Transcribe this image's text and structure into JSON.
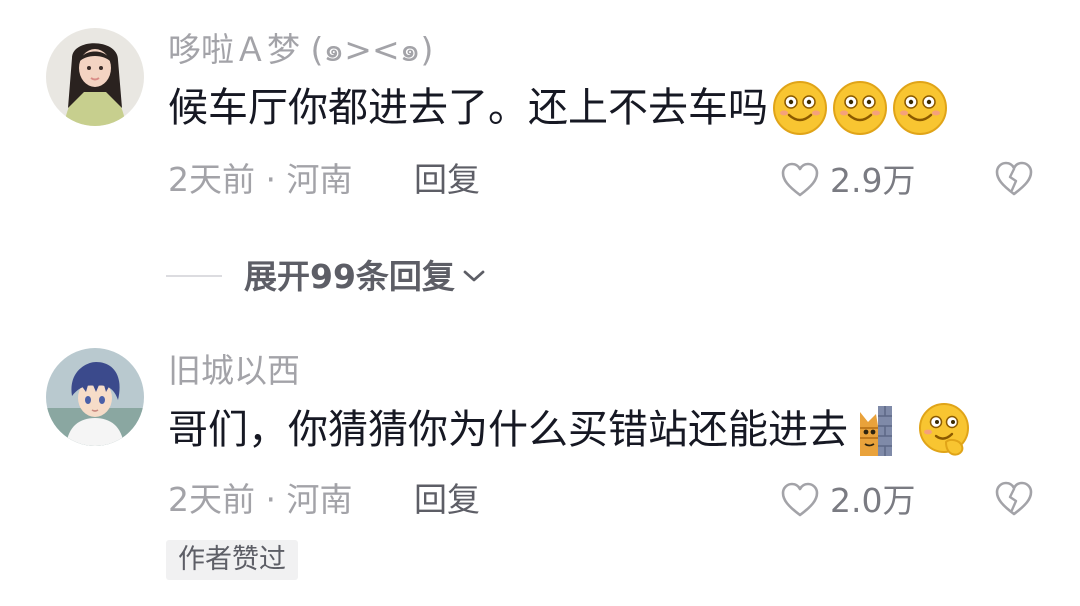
{
  "comments": [
    {
      "username": "哆啦Ａ梦 (๑><๑)",
      "text": "候车厅你都进去了。还上不去车吗",
      "emojis": [
        "smiling-face-emoji",
        "smiling-face-emoji",
        "smiling-face-emoji"
      ],
      "time": "2天前",
      "location": "河南",
      "reply_label": "回复",
      "like_count": "2.9万"
    },
    {
      "username": "旧城以西",
      "text": "哥们，你猜猜你为什么买错站还能进去",
      "emojis": [
        "cat-peeking-wall-emoji",
        "thinking-face-emoji"
      ],
      "time": "2天前",
      "location": "河南",
      "reply_label": "回复",
      "like_count": "2.0万",
      "badge": "作者赞过"
    }
  ],
  "expand_replies": {
    "label": "展开99条回复"
  },
  "colors": {
    "primary_text": "#161823",
    "secondary_text": "#a3a3a8",
    "reply_text": "#5d5e66",
    "badge_bg": "#f1f1f2",
    "emoji_yellow": "#f8c531"
  },
  "icons": {
    "like": "heart-outline-icon",
    "dislike": "broken-heart-icon",
    "expand": "chevron-down-icon"
  }
}
